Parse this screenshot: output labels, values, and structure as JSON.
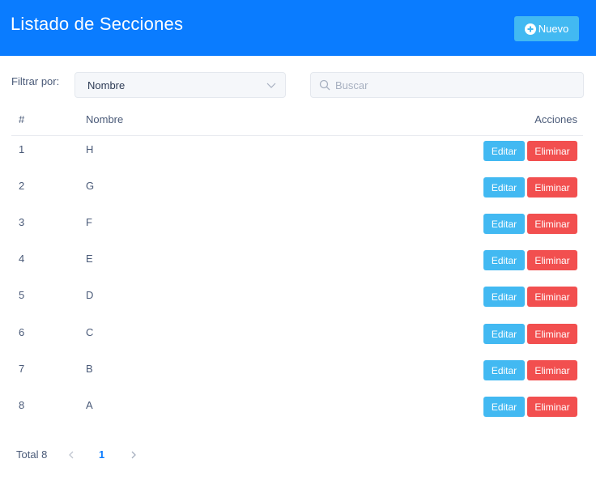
{
  "header": {
    "title": "Listado de Secciones",
    "new_button_label": "Nuevo",
    "new_button_icon": "plus-circle-icon"
  },
  "filter": {
    "label": "Filtrar por:",
    "selected": "Nombre"
  },
  "search": {
    "placeholder": "Buscar",
    "value": ""
  },
  "table": {
    "columns": [
      "#",
      "Nombre",
      "Acciones"
    ],
    "rows": [
      {
        "num": "1",
        "name": "H"
      },
      {
        "num": "2",
        "name": "G"
      },
      {
        "num": "3",
        "name": "F"
      },
      {
        "num": "4",
        "name": "E"
      },
      {
        "num": "5",
        "name": "D"
      },
      {
        "num": "6",
        "name": "C"
      },
      {
        "num": "7",
        "name": "B"
      },
      {
        "num": "8",
        "name": "A"
      }
    ],
    "edit_label": "Editar",
    "delete_label": "Eliminar"
  },
  "pagination": {
    "total_label": "Total 8",
    "current_page": "1"
  },
  "colors": {
    "header_bg": "#0a7cff",
    "edit_bg": "#42b9f2",
    "delete_bg": "#f24f4f",
    "active_page": "#0a7cff"
  }
}
